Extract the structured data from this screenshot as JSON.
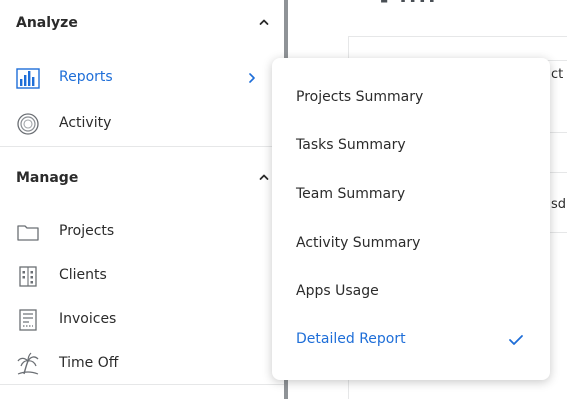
{
  "sidebar": {
    "analyze": {
      "title": "Analyze",
      "items": [
        {
          "label": "Reports",
          "icon": "bar-chart-icon",
          "active": true
        },
        {
          "label": "Activity",
          "icon": "activity-ring-icon"
        }
      ]
    },
    "manage": {
      "title": "Manage",
      "items": [
        {
          "label": "Projects",
          "icon": "folder-icon"
        },
        {
          "label": "Clients",
          "icon": "building-icon"
        },
        {
          "label": "Invoices",
          "icon": "invoice-icon"
        },
        {
          "label": "Time Off",
          "icon": "palm-tree-icon"
        }
      ]
    }
  },
  "content": {
    "partial_title": "- ····",
    "cut_text_1": "ct",
    "cut_text_2": "sd"
  },
  "reports_menu": {
    "items": [
      {
        "label": "Projects Summary"
      },
      {
        "label": "Tasks Summary"
      },
      {
        "label": "Team Summary"
      },
      {
        "label": "Activity Summary"
      },
      {
        "label": "Apps Usage"
      },
      {
        "label": "Detailed Report",
        "selected": true
      }
    ]
  },
  "colors": {
    "accent": "#1e6ed8",
    "text": "#2b2b2b",
    "rail": "#8f9397"
  }
}
